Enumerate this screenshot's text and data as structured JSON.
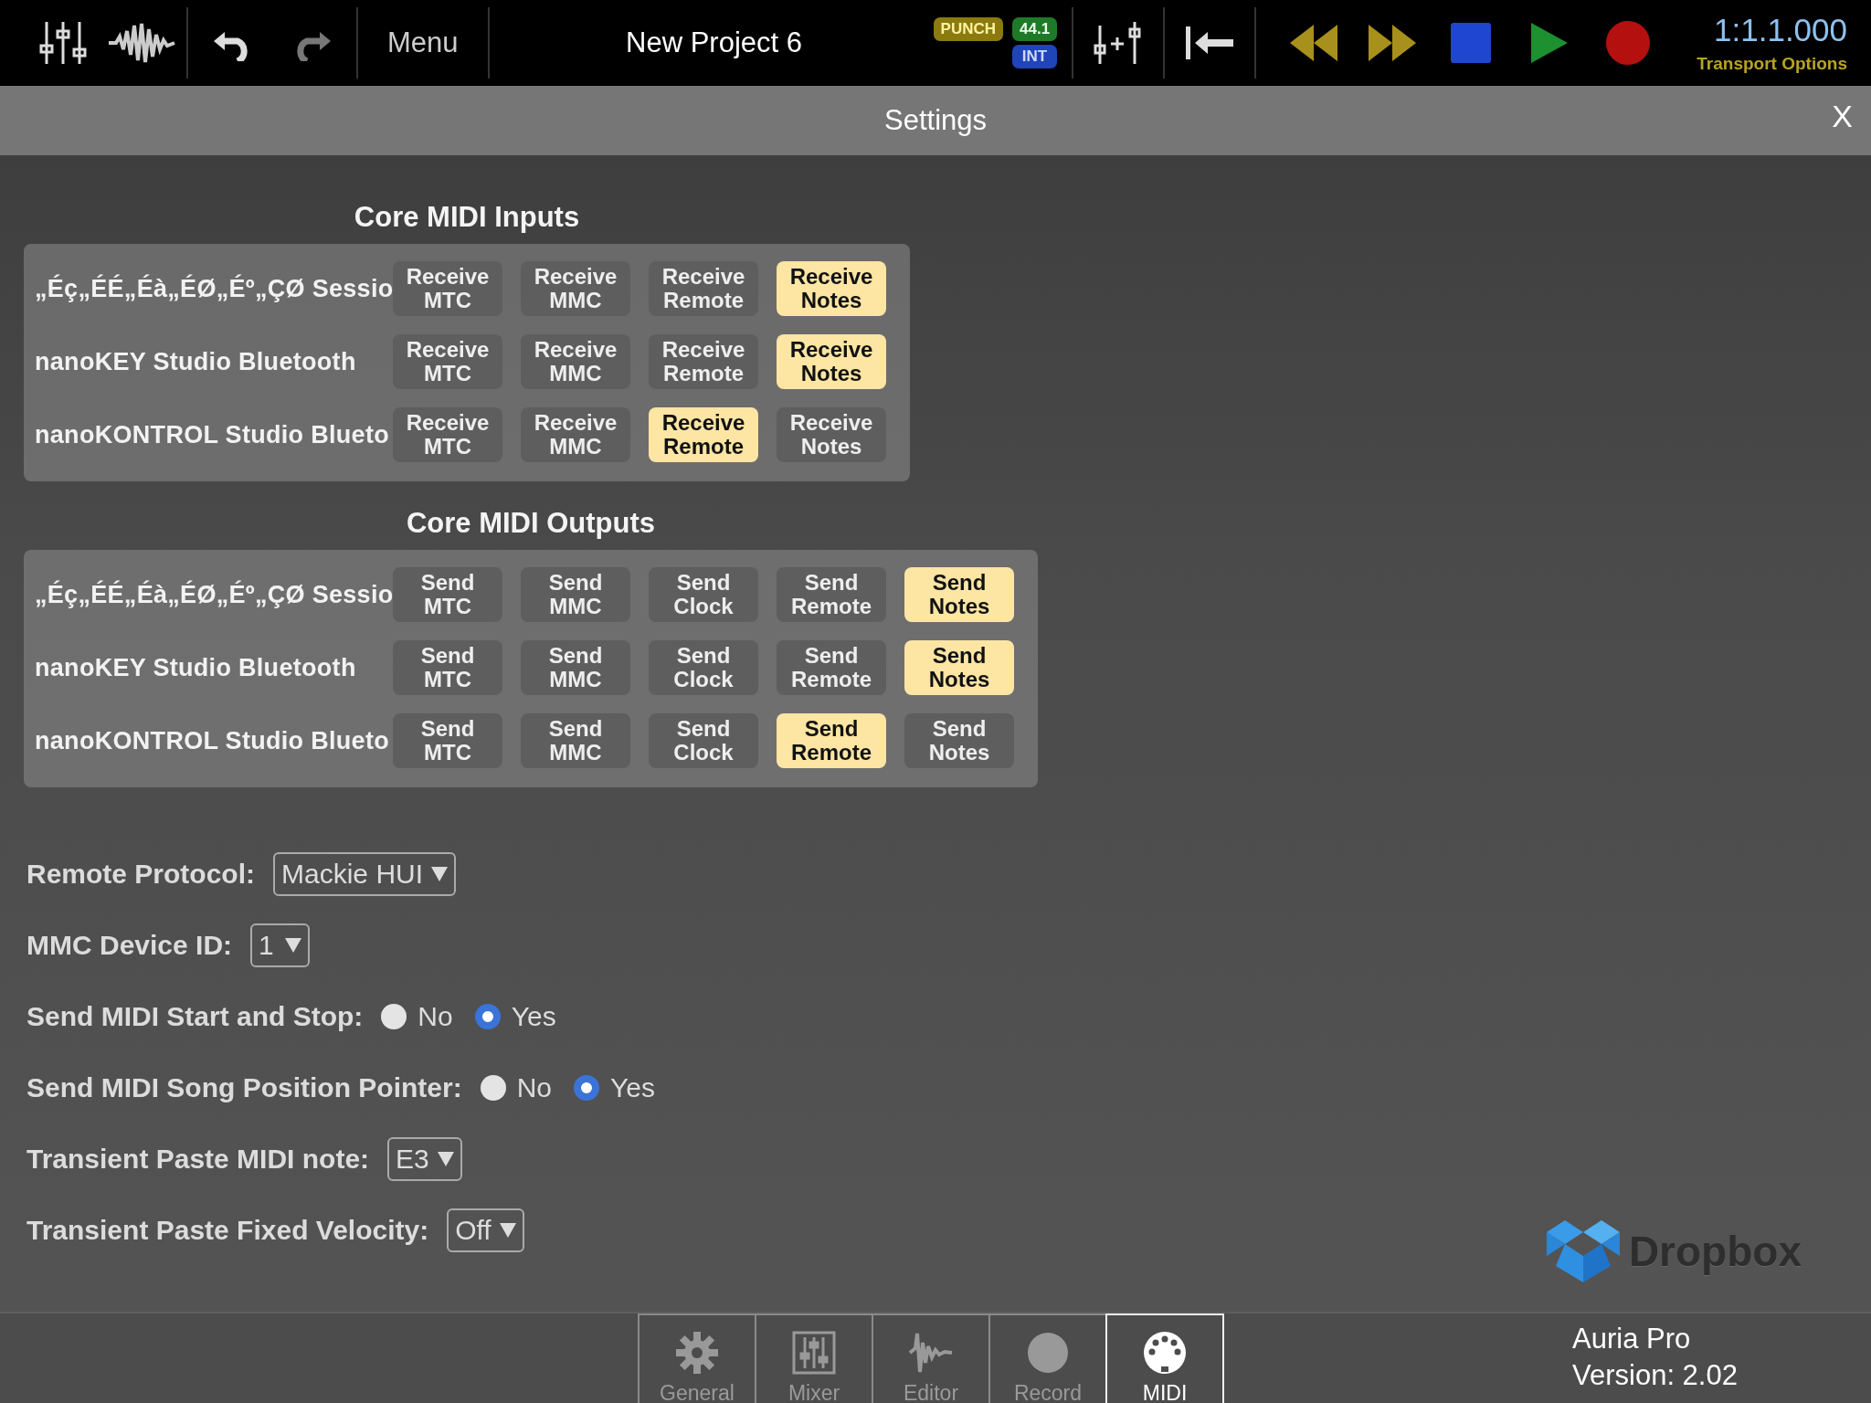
{
  "toolbar": {
    "menu": "Menu",
    "project_title": "New Project 6",
    "punch": "PUNCH",
    "sample_rate": "44.1",
    "clock_source": "INT",
    "position": "1:1.1.000",
    "transport_options": "Transport Options"
  },
  "settings_bar": {
    "title": "Settings",
    "close": "X"
  },
  "inputs": {
    "title": "Core MIDI Inputs",
    "devices": [
      {
        "name": "„Éç„ÉÉ„Éà„ÉØ„Éº„ÇØ Sessio",
        "buttons": [
          {
            "label": "Receive\nMTC",
            "on": false
          },
          {
            "label": "Receive\nMMC",
            "on": false
          },
          {
            "label": "Receive\nRemote",
            "on": false
          },
          {
            "label": "Receive\nNotes",
            "on": true
          }
        ]
      },
      {
        "name": "nanoKEY Studio Bluetooth",
        "buttons": [
          {
            "label": "Receive\nMTC",
            "on": false
          },
          {
            "label": "Receive\nMMC",
            "on": false
          },
          {
            "label": "Receive\nRemote",
            "on": false
          },
          {
            "label": "Receive\nNotes",
            "on": true
          }
        ]
      },
      {
        "name": "nanoKONTROL Studio Blueto",
        "buttons": [
          {
            "label": "Receive\nMTC",
            "on": false
          },
          {
            "label": "Receive\nMMC",
            "on": false
          },
          {
            "label": "Receive\nRemote",
            "on": true
          },
          {
            "label": "Receive\nNotes",
            "on": false
          }
        ]
      }
    ]
  },
  "outputs": {
    "title": "Core MIDI Outputs",
    "devices": [
      {
        "name": "„Éç„ÉÉ„Éà„ÉØ„Éº„ÇØ Sessio",
        "buttons": [
          {
            "label": "Send\nMTC",
            "on": false
          },
          {
            "label": "Send\nMMC",
            "on": false
          },
          {
            "label": "Send\nClock",
            "on": false
          },
          {
            "label": "Send\nRemote",
            "on": false
          },
          {
            "label": "Send\nNotes",
            "on": true
          }
        ]
      },
      {
        "name": "nanoKEY Studio Bluetooth",
        "buttons": [
          {
            "label": "Send\nMTC",
            "on": false
          },
          {
            "label": "Send\nMMC",
            "on": false
          },
          {
            "label": "Send\nClock",
            "on": false
          },
          {
            "label": "Send\nRemote",
            "on": false
          },
          {
            "label": "Send\nNotes",
            "on": true
          }
        ]
      },
      {
        "name": "nanoKONTROL Studio Blueto",
        "buttons": [
          {
            "label": "Send\nMTC",
            "on": false
          },
          {
            "label": "Send\nMMC",
            "on": false
          },
          {
            "label": "Send\nClock",
            "on": false
          },
          {
            "label": "Send\nRemote",
            "on": true
          },
          {
            "label": "Send\nNotes",
            "on": false
          }
        ]
      }
    ]
  },
  "settings": [
    {
      "kind": "dropdown",
      "label": "Remote Protocol:",
      "value": "Mackie HUI"
    },
    {
      "kind": "dropdown",
      "label": "MMC Device ID:",
      "value": "1"
    },
    {
      "kind": "radio",
      "label": "Send MIDI Start and Stop:",
      "options": [
        {
          "label": "No",
          "selected": false
        },
        {
          "label": "Yes",
          "selected": true
        }
      ]
    },
    {
      "kind": "radio",
      "label": "Send MIDI Song Position Pointer:",
      "options": [
        {
          "label": "No",
          "selected": false
        },
        {
          "label": "Yes",
          "selected": true
        }
      ]
    },
    {
      "kind": "dropdown",
      "label": "Transient Paste MIDI note:",
      "value": "E3"
    },
    {
      "kind": "dropdown",
      "label": "Transient Paste Fixed Velocity:",
      "value": "Off"
    }
  ],
  "dropbox": {
    "label": "Dropbox"
  },
  "tabs": [
    {
      "kind": "general",
      "label": "General",
      "selected": false
    },
    {
      "kind": "mixer",
      "label": "Mixer",
      "selected": false
    },
    {
      "kind": "editor",
      "label": "Editor",
      "selected": false
    },
    {
      "kind": "record",
      "label": "Record",
      "selected": false
    },
    {
      "kind": "midi",
      "label": "MIDI",
      "selected": true
    }
  ],
  "app_info": {
    "name": "Auria Pro",
    "version": "Version: 2.02"
  }
}
